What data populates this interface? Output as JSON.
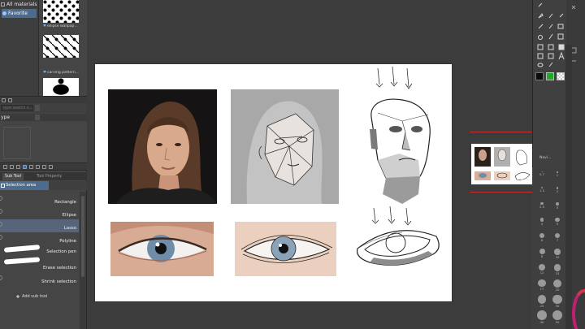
{
  "materials": {
    "tree": [
      "All materials",
      "Favorite"
    ],
    "thumb_labels": [
      "ellipse wallpap...",
      "carving pattern...",
      "wallpaper pattern..."
    ],
    "search_placeholder": "Type search k...",
    "type_label": "ype"
  },
  "subtool_panel": {
    "tabs": [
      "Sub Tool",
      "Tool Property"
    ],
    "group": "Selection area",
    "tools": [
      {
        "label": "Rectangle",
        "active": false
      },
      {
        "label": "Ellipse",
        "active": false
      },
      {
        "label": "Lasso",
        "active": true
      },
      {
        "label": "Polyline",
        "active": false
      },
      {
        "label": "Selection pen",
        "active": false
      },
      {
        "label": "Erase selection",
        "active": false
      },
      {
        "label": "Shrink selection",
        "active": false
      }
    ],
    "add_button": "Add sub tool"
  },
  "navigator": {
    "label": "Navi..."
  },
  "colors": {
    "main": "#0b0b0b",
    "sub": "#1faa2e",
    "accent": "#4d6b8d",
    "nav_frame": "#c43030"
  },
  "brush_sizes": [
    "0.7",
    "1",
    "1.5",
    "2",
    "2.5",
    "3",
    "4",
    "5",
    "6",
    "7",
    "8",
    "10",
    "12",
    "15",
    "17",
    "20",
    "25",
    "30",
    "40",
    "50"
  ]
}
